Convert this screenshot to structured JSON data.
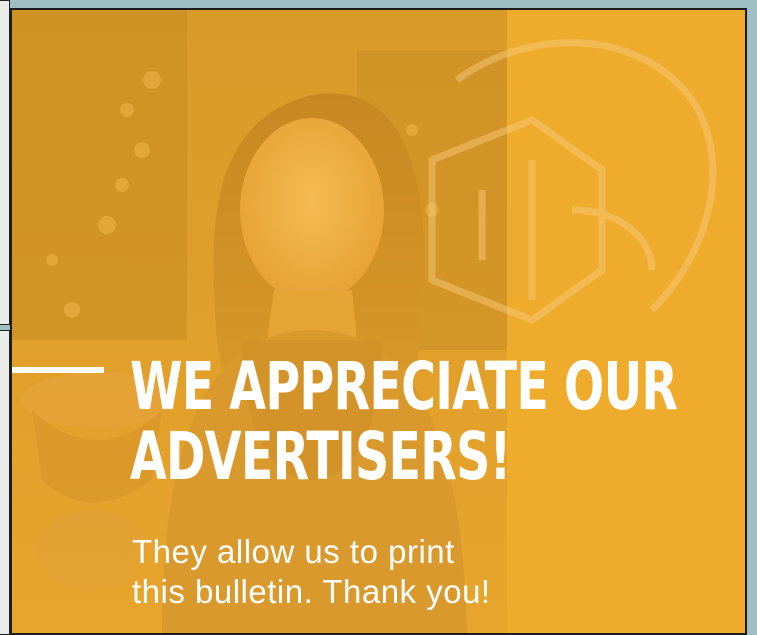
{
  "ad": {
    "headline": [
      "WE APPRECIATE OUR",
      "ADVERTISERS!"
    ],
    "subtext": [
      "They allow us to print",
      "this bulletin. Thank you!"
    ]
  },
  "colors": {
    "background": "#9fbfc3",
    "ad_orange": "#efab2c",
    "text": "#ffffff",
    "border": "#1c1c1c"
  },
  "icons": {
    "watermark": "outline-house-hand-icon"
  }
}
